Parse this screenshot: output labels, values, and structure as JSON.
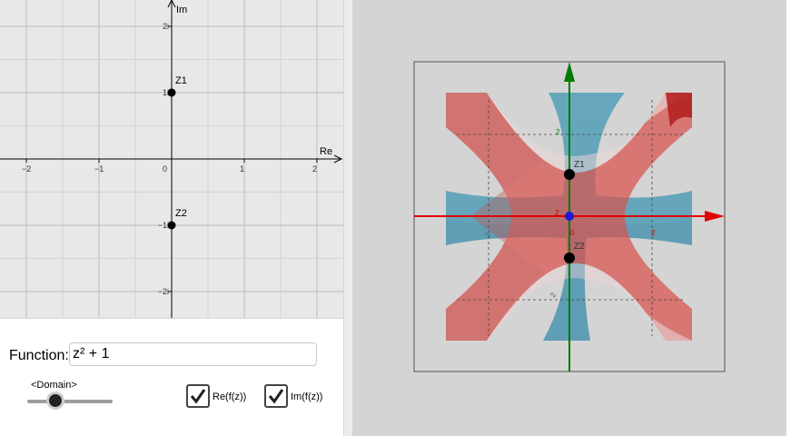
{
  "plane": {
    "axis_x_label": "Re",
    "axis_y_label": "Im",
    "x_ticks": [
      {
        "value": -2,
        "label": "−2"
      },
      {
        "value": -1,
        "label": "−1"
      },
      {
        "value": 0,
        "label": "0"
      },
      {
        "value": 1,
        "label": "1"
      },
      {
        "value": 2,
        "label": "2"
      }
    ],
    "y_ticks": [
      {
        "value": 2,
        "label": "2i"
      },
      {
        "value": 1,
        "label": "1i"
      },
      {
        "value": -1,
        "label": "−1i"
      },
      {
        "value": -2,
        "label": "−2i"
      }
    ],
    "points": [
      {
        "name": "Z1",
        "re": 0,
        "im": 1
      },
      {
        "name": "Z2",
        "re": 0,
        "im": -1
      }
    ]
  },
  "controls": {
    "function_label": "Function:",
    "function_value": "z² + 1",
    "slider_label": "<Domain>",
    "slider_fraction": 0.33,
    "checkbox_re_label": "Re(f(z))",
    "checkbox_re_checked": true,
    "checkbox_im_label": "Im(f(z))",
    "checkbox_im_checked": true
  },
  "view3d": {
    "ticks_x": [
      "2",
      "0",
      "2"
    ],
    "ticks_y": [
      "2",
      "2"
    ],
    "ticks_z": [
      "2",
      "2"
    ],
    "point_labels": [
      "Z1",
      "Z2"
    ],
    "colors": {
      "re_surface": "#d9534f",
      "im_surface": "#4a9bb5",
      "axis_x": "#e00000",
      "axis_z": "#007a00",
      "origin": "#1b1bd6"
    }
  }
}
